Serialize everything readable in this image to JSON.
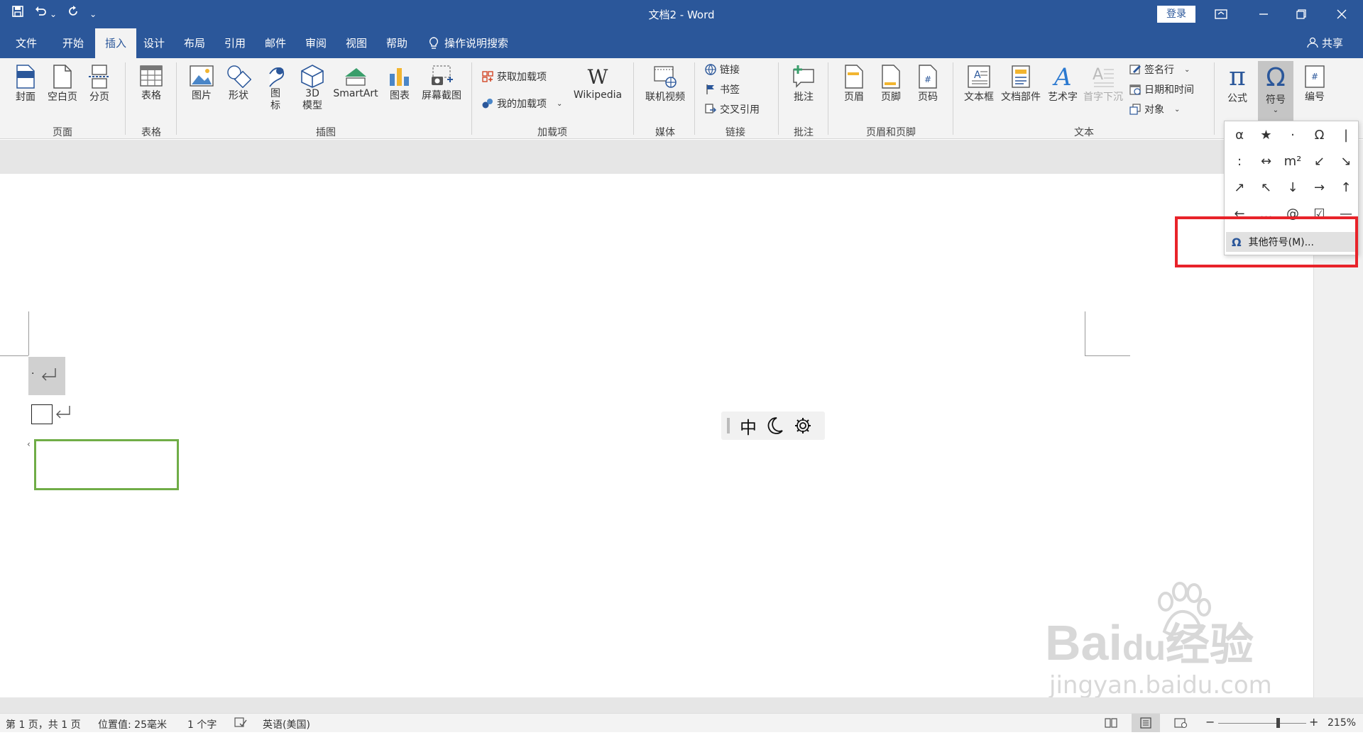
{
  "titlebar": {
    "title": "文档2  -  Word",
    "login": "登录",
    "qat_undo_arrow": "⌄",
    "qat_more": "⌄"
  },
  "tabs": [
    "文件",
    "开始",
    "插入",
    "设计",
    "布局",
    "引用",
    "邮件",
    "审阅",
    "视图",
    "帮助"
  ],
  "tell_me": "操作说明搜索",
  "share": "共享",
  "ribbon": {
    "pages": {
      "cover": "封面",
      "blank": "空白页",
      "break": "分页",
      "group": "页面"
    },
    "tables": {
      "table": "表格",
      "group": "表格"
    },
    "illustrations": {
      "picture": "图片",
      "shapes": "形状",
      "icons_1": "图",
      "icons_2": "标",
      "model_1": "3D",
      "model_2": "模型",
      "smartart": "SmartArt",
      "chart": "图表",
      "screenshot": "屏幕截图",
      "group": "插图"
    },
    "addins": {
      "get": "获取加载项",
      "my": "我的加载项",
      "wikipedia": "Wikipedia",
      "group": "加载项"
    },
    "media": {
      "video": "联机视频",
      "group": "媒体"
    },
    "links": {
      "link": "链接",
      "bookmark": "书签",
      "crossref": "交叉引用",
      "group": "链接"
    },
    "comments": {
      "comment": "批注",
      "group": "批注"
    },
    "headerfooter": {
      "header": "页眉",
      "footer": "页脚",
      "pagenum": "页码",
      "group": "页眉和页脚"
    },
    "text": {
      "textbox": "文本框",
      "quickparts": "文档部件",
      "wordart": "艺术字",
      "dropcap": "首字下沉",
      "signature": "签名行",
      "datetime": "日期和时间",
      "object": "对象",
      "group": "文本"
    },
    "symbols": {
      "equation": "公式",
      "symbol": "符号",
      "number": "编号"
    }
  },
  "symbol_dropdown": {
    "symbols": [
      "α",
      "★",
      "·",
      "Ω",
      "|",
      ":",
      "↔",
      "m²",
      "↙",
      "↘",
      "↗",
      "↖",
      "↓",
      "→",
      "↑",
      "←",
      "…",
      "@",
      "☑",
      "—"
    ],
    "more_label": "其他符号(M)..."
  },
  "ime": {
    "lang": "中"
  },
  "watermark": {
    "brand": "Bai",
    "brand_du": "du",
    "cn": "经验",
    "url": "jingyan.baidu.com"
  },
  "status": {
    "page": "第 1 页，共 1 页",
    "position": "位置值: 25毫米",
    "words": "1 个字",
    "language": "英语(美国)",
    "zoom": "215%",
    "zoom_fraction": 0.68
  }
}
